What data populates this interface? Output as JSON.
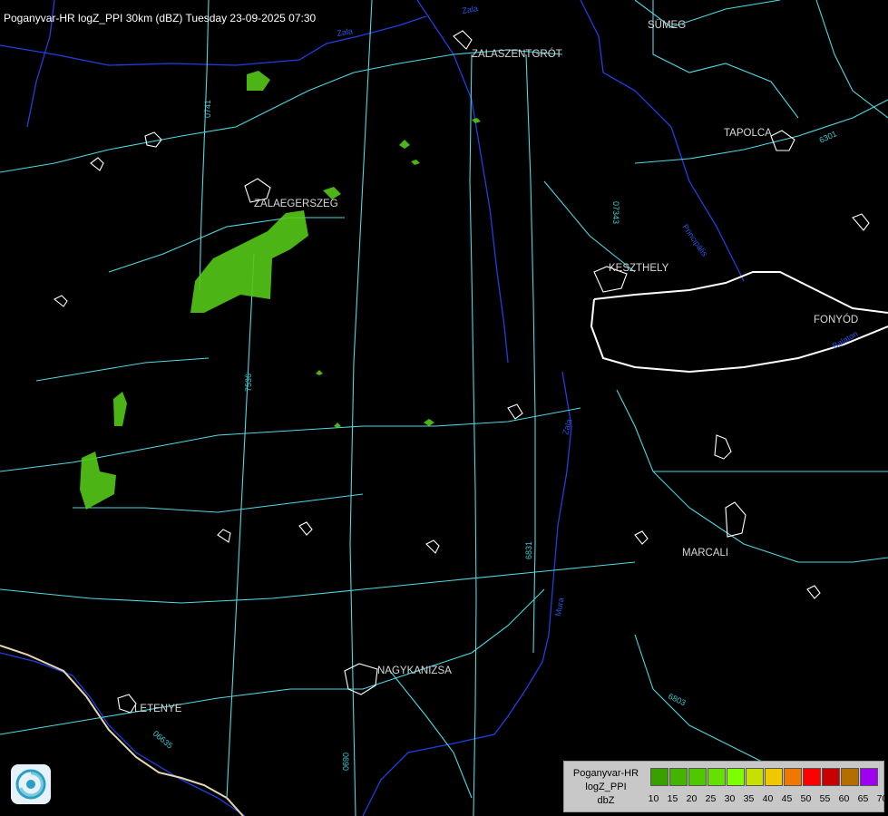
{
  "title": "Poganyvar-HR logZ_PPI 30km (dBZ) Tuesday 23-09-2025 07:30",
  "cities": [
    {
      "id": "sumeg",
      "name": "SÜMEG"
    },
    {
      "id": "zalaszentgrot",
      "name": "ZALASZENTGRÓT"
    },
    {
      "id": "tapolca",
      "name": "TAPOLCA"
    },
    {
      "id": "zalaegerszeg",
      "name": "ZALAEGERSZEG"
    },
    {
      "id": "keszthely",
      "name": "KESZTHELY"
    },
    {
      "id": "fonyod",
      "name": "FONYÓD"
    },
    {
      "id": "marcali",
      "name": "MARCALI"
    },
    {
      "id": "nagykanizsa",
      "name": "NAGYKANIZSA"
    },
    {
      "id": "letenye",
      "name": "LETENYE"
    }
  ],
  "road_labels": [
    "0741",
    "07343",
    "6301",
    "7536",
    "6831",
    "6803",
    "0690",
    "06635"
  ],
  "river_labels": [
    "Zala",
    "Zala",
    "Principális",
    "Balaton",
    "Zala",
    "Mura"
  ],
  "legend": {
    "name_lines": [
      "Poganyvar-HR",
      "logZ_PPI",
      "dbZ"
    ],
    "levels": [
      10,
      15,
      20,
      25,
      30,
      35,
      40,
      45,
      50,
      55,
      60,
      65,
      70
    ],
    "colors": [
      "#3aa000",
      "#45b400",
      "#50c800",
      "#66e000",
      "#7cff00",
      "#c8e000",
      "#f0c800",
      "#f07800",
      "#ff0000",
      "#c80000",
      "#b46e00",
      "#a000f0",
      "#b4b4ff"
    ]
  },
  "colors": {
    "roads": "#4fd8e0",
    "rivers": "#1f3fe0",
    "border": "#e8d8b0",
    "towns": "#ffffff",
    "echo": "#55c818"
  }
}
